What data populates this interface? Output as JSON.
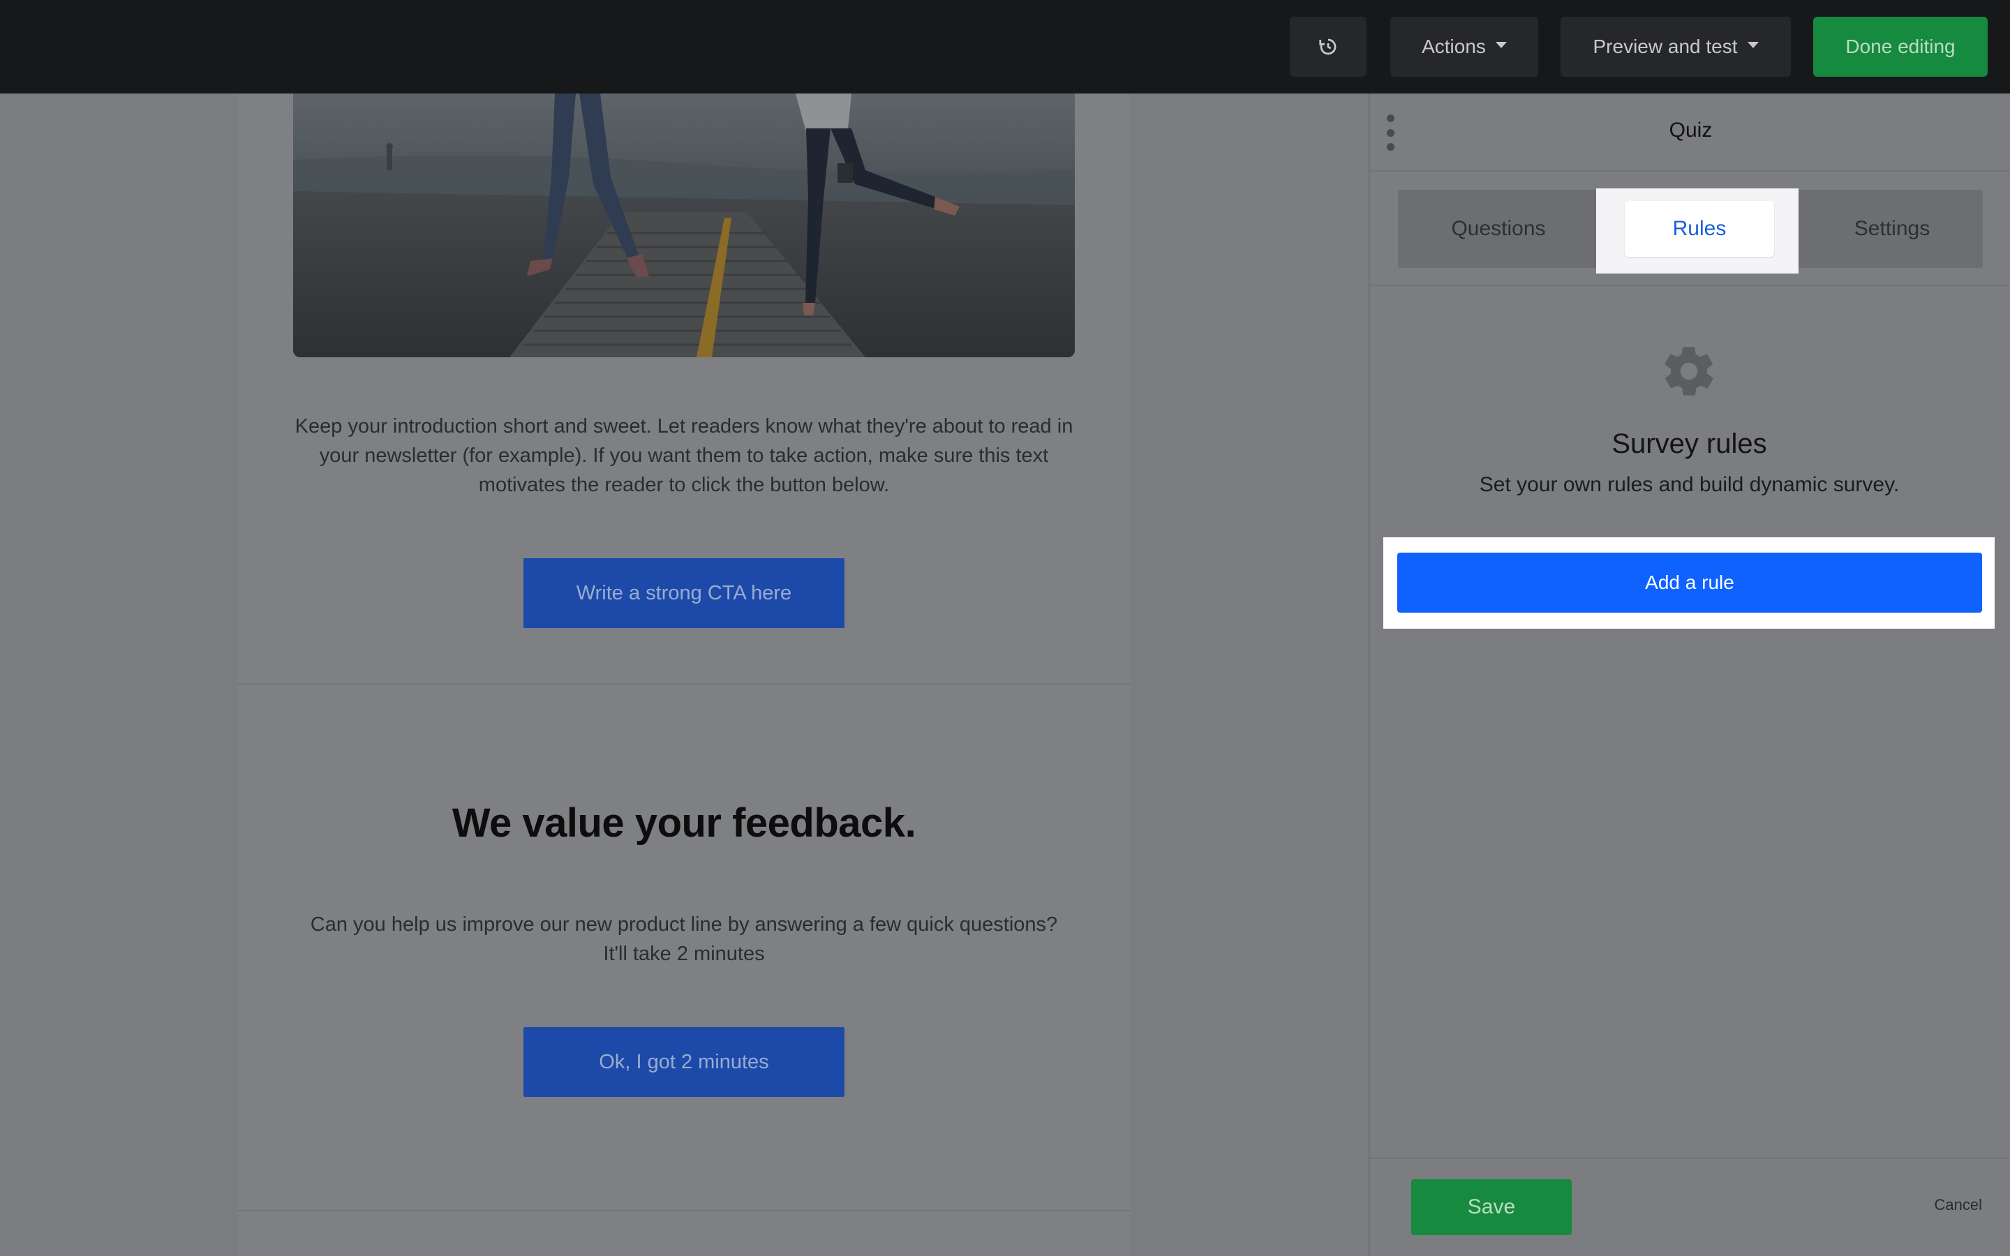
{
  "topbar": {
    "history_icon": "history-icon",
    "actions_label": "Actions",
    "preview_label": "Preview and test",
    "done_label": "Done editing"
  },
  "canvas": {
    "intro_text": "Keep your introduction short and sweet. Let readers know what they're about to read in your newsletter (for example). If you want them to take action, make sure this text motivates the reader to click the button below.",
    "cta_1": "Write a strong CTA here",
    "feedback_title": "We value your feedback.",
    "feedback_text": "Can you help us improve our new product line by answering a few quick questions? It'll take 2 minutes",
    "cta_2": "Ok, I got 2 minutes"
  },
  "panel": {
    "title": "Quiz",
    "tabs": [
      {
        "label": "Questions"
      },
      {
        "label": "Rules"
      },
      {
        "label": "Settings"
      }
    ],
    "active_tab": "Rules",
    "icon": "gear-icon",
    "heading": "Survey rules",
    "subtext": "Set your own rules and build dynamic survey.",
    "add_rule_label": "Add a rule",
    "save_label": "Save",
    "cancel_label": "Cancel"
  },
  "colors": {
    "topbar_bg": "#17181a",
    "done_button": "#168a3e",
    "primary_blue": "#0f62fe",
    "active_tab_text": "#1a5fdc"
  }
}
